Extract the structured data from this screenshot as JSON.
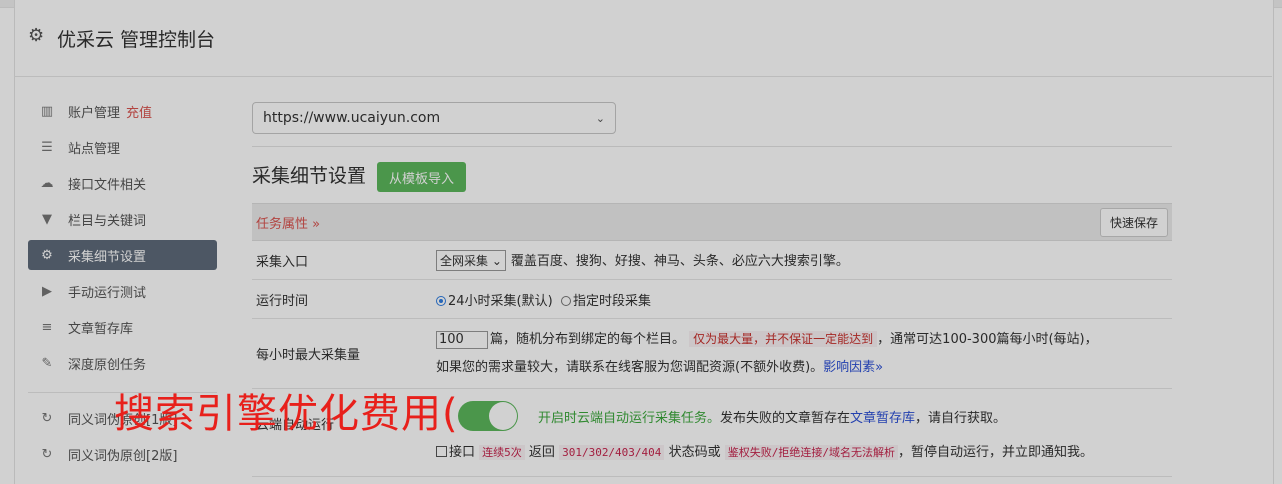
{
  "header": {
    "title": "优采云 管理控制台",
    "icon": "gear-icon"
  },
  "sidebar": {
    "items": [
      {
        "label": "账户管理",
        "badge": "充值",
        "icon": "bar-chart-icon"
      },
      {
        "label": "站点管理",
        "icon": "server-icon"
      },
      {
        "label": "接口文件相关",
        "icon": "cloud-upload-icon"
      },
      {
        "label": "栏目与关键词",
        "icon": "filter-icon"
      },
      {
        "label": "采集细节设置",
        "icon": "cogs-icon",
        "active": true
      },
      {
        "label": "手动运行测试",
        "icon": "play-circle-icon"
      },
      {
        "label": "文章暂存库",
        "icon": "database-icon"
      },
      {
        "label": "深度原创任务",
        "icon": "edit-icon"
      },
      {
        "label": "同义词伪原创[1版]",
        "icon": "refresh-icon"
      },
      {
        "label": "同义词伪原创[2版]",
        "icon": "refresh-icon"
      }
    ]
  },
  "main": {
    "site_select": "https://www.ucaiyun.com",
    "heading": "采集细节设置",
    "import_button": "从模板导入",
    "section_title": "任务属性 »",
    "quick_save": "快速保存",
    "rows": {
      "entry": {
        "label": "采集入口",
        "select": "全网采集",
        "desc": "覆盖百度、搜狗、好搜、神马、头条、必应六大搜索引擎。"
      },
      "runtime": {
        "label": "运行时间",
        "opt1": "24小时采集(默认)",
        "opt2": "指定时段采集"
      },
      "max": {
        "label": "每小时最大采集量",
        "value": "100",
        "text1": "篇，随机分布到绑定的每个栏目。",
        "warn": "仅为最大量，并不保证一定能达到",
        "text2": "，通常可达100-300篇每小时(每站)，",
        "text3": "如果您的需求量较大，请联系在线客服为您调配资源(不额外收费)。",
        "link": "影响因素»"
      },
      "cloud": {
        "label": "云端自动运行",
        "green": "开启时云端自动运行采集任务。",
        "text1": "发布失败的文章暂存在",
        "link": "文章暂存库",
        "text2": "，请自行获取。",
        "chk_label": "接口",
        "code1": "连续5次",
        "text3": "返回",
        "code2": "301/302/403/404",
        "text4": "状态码或",
        "code3": "鉴权失败/拒绝连接/域名无法解析",
        "text5": "，暂停自动运行，并立即通知我。"
      }
    }
  },
  "watermark": "搜索引擎优化费用("
}
